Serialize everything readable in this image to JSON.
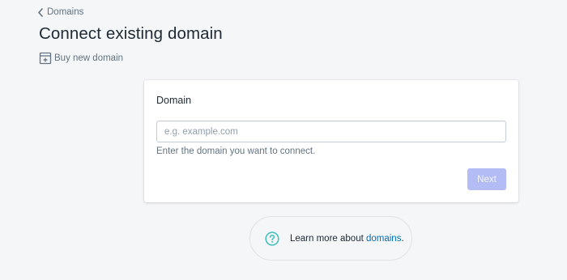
{
  "breadcrumb": {
    "label": "Domains",
    "icon": "chevron-left-icon"
  },
  "page": {
    "title": "Connect existing domain"
  },
  "secondary_action": {
    "label": "Buy new domain",
    "icon": "buy-domain-icon"
  },
  "card": {
    "title": "Domain",
    "input": {
      "value": "",
      "placeholder": "e.g. example.com"
    },
    "help_text": "Enter the domain you want to connect.",
    "next_label": "Next"
  },
  "footer_help": {
    "icon": "question-circle-icon",
    "text_before": "Learn more about ",
    "link_text": "domains",
    "text_after": "."
  },
  "colors": {
    "background": "#f4f6f8",
    "accent_disabled": "#b3bcf5",
    "link": "#006fbb",
    "help_icon": "#47c1bf"
  }
}
